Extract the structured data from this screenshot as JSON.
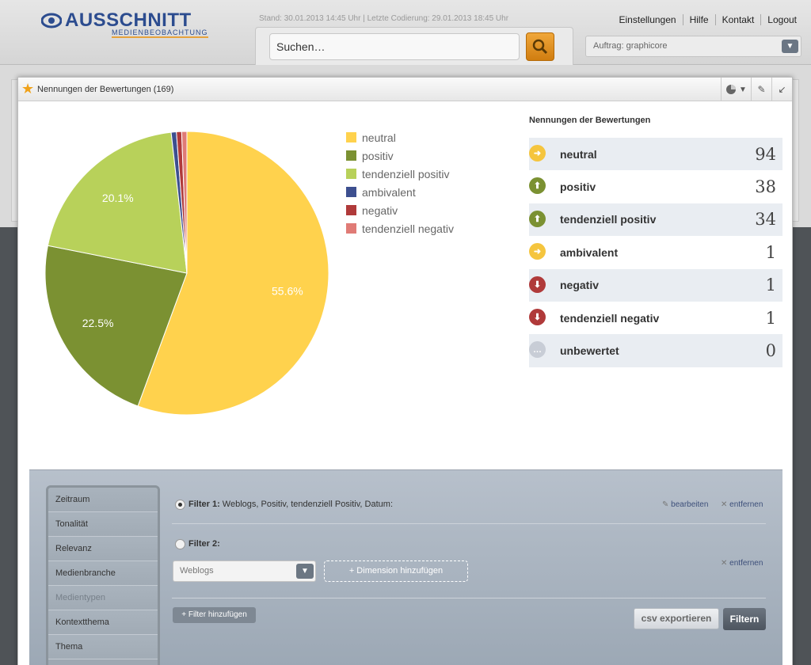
{
  "header": {
    "logo_main": "AUSSCHNITT",
    "logo_sub": "MEDIENBEOBACHTUNG",
    "stand": "Stand: 30.01.2013 14:45 Uhr | Letzte Codierung: 29.01.2013 18:45 Uhr",
    "nav": [
      "Einstellungen",
      "Hilfe",
      "Kontakt",
      "Logout"
    ],
    "search_placeholder": "Suchen…",
    "auftrag": "Auftrag: graphicore"
  },
  "dialog": {
    "title": "Nennungen der Bewertungen (169)",
    "icons": [
      "pie-chart-icon",
      "chevron-down-icon",
      "pencil-icon",
      "collapse-icon"
    ]
  },
  "chart_data": {
    "type": "pie",
    "categories": [
      "neutral",
      "positiv",
      "tendenziell positiv",
      "ambivalent",
      "negativ",
      "tendenziell negativ"
    ],
    "values": [
      94,
      38,
      34,
      1,
      1,
      1
    ],
    "colors": [
      "#ffd24d",
      "#7b9132",
      "#b8d15a",
      "#3d4f8f",
      "#b03a3a",
      "#e07b76"
    ],
    "data_labels": [
      "55.6%",
      "22.5%",
      "20.1%",
      "",
      "",
      ""
    ],
    "legend_position": "right"
  },
  "table": {
    "title": "Nennungen der Bewertungen",
    "rows": [
      {
        "label": "neutral",
        "value": "94",
        "icon": "arrow-right-icon",
        "color": "#f5c53e"
      },
      {
        "label": "positiv",
        "value": "38",
        "icon": "arrow-up-icon",
        "color": "#7b9132"
      },
      {
        "label": "tendenziell positiv",
        "value": "34",
        "icon": "arrow-up-icon",
        "color": "#7b9132"
      },
      {
        "label": "ambivalent",
        "value": "1",
        "icon": "arrow-right-icon",
        "color": "#f5c53e"
      },
      {
        "label": "negativ",
        "value": "1",
        "icon": "arrow-down-icon",
        "color": "#b03a3a"
      },
      {
        "label": "tendenziell negativ",
        "value": "1",
        "icon": "arrow-down-icon",
        "color": "#b03a3a"
      },
      {
        "label": "unbewertet",
        "value": "0",
        "icon": "ellipsis-icon",
        "color": "#c8cdd6"
      }
    ]
  },
  "filter": {
    "nav": [
      "Zeitraum",
      "Tonalität",
      "Relevanz",
      "Medienbranche",
      "Medientypen",
      "Kontextthema",
      "Thema"
    ],
    "filter1_label": "Filter 1:",
    "filter1_text": "Weblogs, Positiv, tendenziell Positiv, Datum:",
    "edit": "bearbeiten",
    "remove": "entfernen",
    "filter2_label": "Filter 2:",
    "select_value": "Weblogs",
    "dimension_button": "+ Dimension hinzufügen",
    "add_filter": "+ Filter hinzufügen",
    "csv": "csv exportieren",
    "filter_button": "Filtern"
  }
}
